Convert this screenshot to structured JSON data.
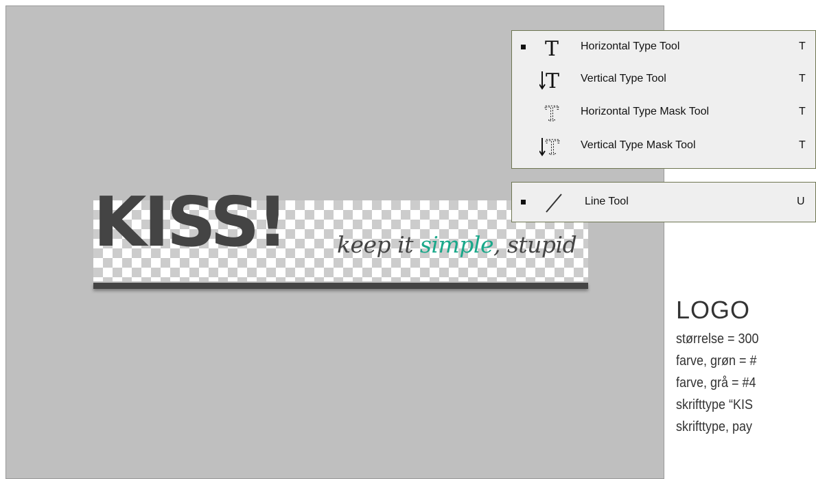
{
  "logo": {
    "kiss_text": "KISS!",
    "tagline_before": "keep it ",
    "tagline_highlight": "simple",
    "tagline_after": ", stupid",
    "colors": {
      "green": "#1aa88a",
      "gray": "#444444"
    }
  },
  "type_menu": {
    "items": [
      {
        "label": "Horizontal Type Tool",
        "shortcut": "T",
        "selected": true,
        "icon": "horizontal-type-icon"
      },
      {
        "label": "Vertical Type Tool",
        "shortcut": "T",
        "selected": false,
        "icon": "vertical-type-icon"
      },
      {
        "label": "Horizontal Type Mask Tool",
        "shortcut": "T",
        "selected": false,
        "icon": "horizontal-type-mask-icon"
      },
      {
        "label": "Vertical Type Mask Tool",
        "shortcut": "T",
        "selected": false,
        "icon": "vertical-type-mask-icon"
      }
    ]
  },
  "line_menu": {
    "items": [
      {
        "label": "Line Tool",
        "shortcut": "U",
        "selected": true,
        "icon": "line-tool-icon"
      }
    ]
  },
  "notes": {
    "heading": "LOGO",
    "lines": [
      "størrelse = 300",
      "farve, grøn = #",
      "farve, grå = #4",
      "skrifttype “KIS",
      "skrifttype, pay"
    ]
  }
}
